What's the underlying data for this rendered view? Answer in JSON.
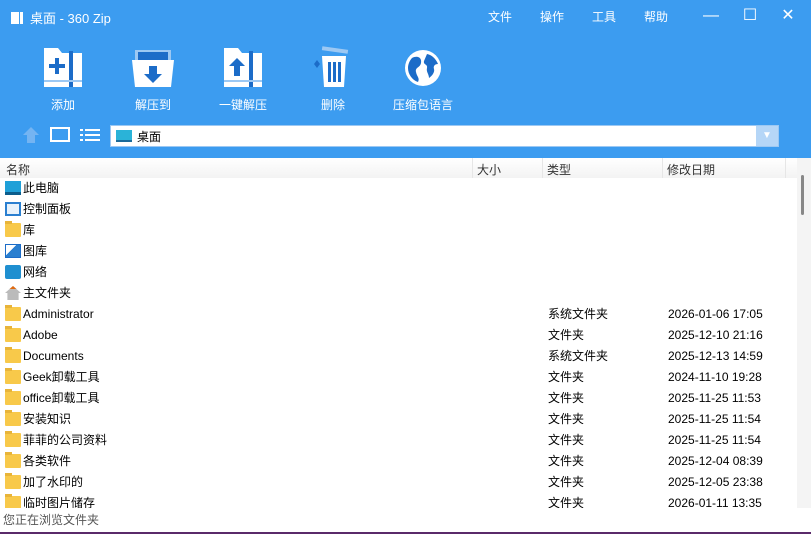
{
  "window": {
    "title": "桌面 - 360 Zip",
    "menus": [
      "文件",
      "操作",
      "工具",
      "帮助"
    ]
  },
  "toolbar": [
    {
      "label": "添加",
      "icon": "add-archive-icon"
    },
    {
      "label": "解压到",
      "icon": "extract-to-icon"
    },
    {
      "label": "一键解压",
      "icon": "one-click-extract-icon"
    },
    {
      "label": "删除",
      "icon": "trash-icon"
    },
    {
      "label": "压缩包语言",
      "icon": "globe-icon"
    }
  ],
  "address": {
    "value": "桌面"
  },
  "columns": {
    "name": "名称",
    "size": "大小",
    "type": "类型",
    "date": "修改日期"
  },
  "rows": [
    {
      "name": "此电脑",
      "icon": "computer",
      "type": "",
      "date": ""
    },
    {
      "name": "控制面板",
      "icon": "control",
      "type": "",
      "date": ""
    },
    {
      "name": "库",
      "icon": "folder",
      "type": "",
      "date": ""
    },
    {
      "name": "图库",
      "icon": "gallery",
      "type": "",
      "date": ""
    },
    {
      "name": "网络",
      "icon": "network",
      "type": "",
      "date": ""
    },
    {
      "name": "主文件夹",
      "icon": "home",
      "type": "",
      "date": ""
    },
    {
      "name": "Administrator",
      "icon": "folder",
      "type": "系统文件夹",
      "date": "2026-01-06 17:05"
    },
    {
      "name": "Adobe",
      "icon": "folder",
      "type": "文件夹",
      "date": "2025-12-10 21:16"
    },
    {
      "name": "Documents",
      "icon": "folder",
      "type": "系统文件夹",
      "date": "2025-12-13 14:59"
    },
    {
      "name": "Geek卸载工具",
      "icon": "folder",
      "type": "文件夹",
      "date": "2024-11-10 19:28"
    },
    {
      "name": "office卸载工具",
      "icon": "folder",
      "type": "文件夹",
      "date": "2025-11-25 11:53"
    },
    {
      "name": "安装知识",
      "icon": "folder",
      "type": "文件夹",
      "date": "2025-11-25 11:54"
    },
    {
      "name": "菲菲的公司资料",
      "icon": "folder",
      "type": "文件夹",
      "date": "2025-11-25 11:54"
    },
    {
      "name": "各类软件",
      "icon": "folder",
      "type": "文件夹",
      "date": "2025-12-04 08:39"
    },
    {
      "name": "加了水印的",
      "icon": "folder",
      "type": "文件夹",
      "date": "2025-12-05 23:38"
    },
    {
      "name": "临时图片储存",
      "icon": "folder",
      "type": "文件夹",
      "date": "2026-01-11 13:35"
    }
  ],
  "status": "您正在浏览文件夹"
}
